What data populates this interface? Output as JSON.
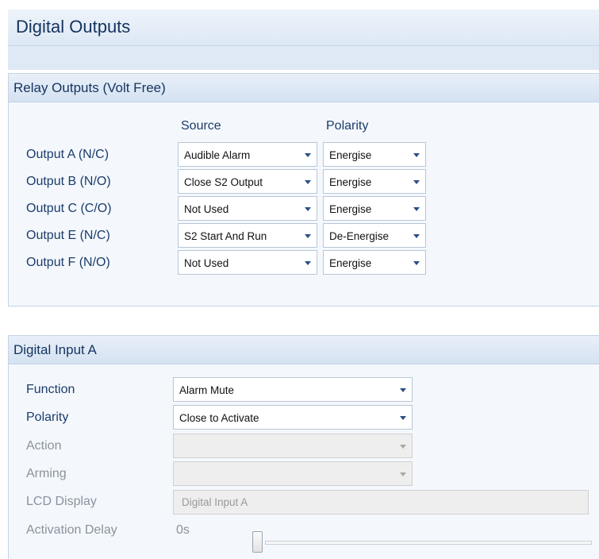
{
  "page_title": "Digital Outputs",
  "relay_group": {
    "title": "Relay Outputs (Volt Free)",
    "col_source": "Source",
    "col_polarity": "Polarity",
    "rows": [
      {
        "label": "Output A (N/C)",
        "source": "Audible Alarm",
        "polarity": "Energise"
      },
      {
        "label": "Output B (N/O)",
        "source": "Close S2 Output",
        "polarity": "Energise"
      },
      {
        "label": "Output C (C/O)",
        "source": "Not Used",
        "polarity": "Energise"
      },
      {
        "label": "Output E (N/C)",
        "source": "S2 Start And Run",
        "polarity": "De-Energise"
      },
      {
        "label": "Output F (N/O)",
        "source": "Not Used",
        "polarity": "Energise"
      }
    ]
  },
  "input_group": {
    "title": "Digital Input A",
    "function_label": "Function",
    "function_value": "Alarm Mute",
    "polarity_label": "Polarity",
    "polarity_value": "Close to Activate",
    "action_label": "Action",
    "action_value": "",
    "arming_label": "Arming",
    "arming_value": "",
    "lcd_label": "LCD Display",
    "lcd_value": "Digital Input A",
    "delay_label": "Activation Delay",
    "delay_value": "0s",
    "delay_slider_fraction": 0
  },
  "colors": {
    "label_text": "#1b3c6b",
    "disabled_text": "#8a929c",
    "panel_bg": "#f4f8fd",
    "header_bg": "#dde8f5",
    "dropdown_arrow": "#2a4f84"
  },
  "icons": [
    "chevron-down-icon"
  ]
}
